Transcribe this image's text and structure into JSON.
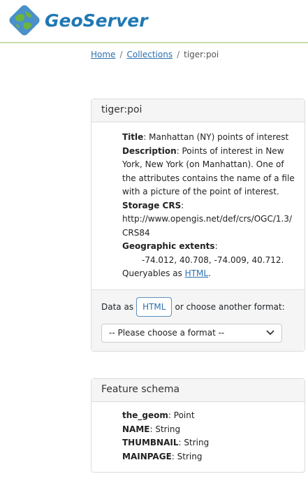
{
  "header": {
    "brand": "GeoServer"
  },
  "breadcrumb": {
    "home": "Home",
    "collections": "Collections",
    "current": "tiger:poi",
    "separator": "/"
  },
  "collection": {
    "title_header": "tiger:poi",
    "title_label": "Title",
    "title_value": ": Manhattan (NY) points of interest",
    "description_label": "Description",
    "description_value": ": Points of interest in New York, New York (on Manhattan). One of the attributes contains the name of a file with a picture of the point of interest.",
    "crs_label": "Storage CRS",
    "crs_colon": ":",
    "crs_value": "http://www.opengis.net/def/crs/OGC/1.3/CRS84",
    "extents_label": "Geographic extents",
    "extents_colon": ":",
    "extents_value": "-74.012, 40.708, -74.009, 40.712.",
    "queryables_prefix": "Queryables as ",
    "queryables_link": "HTML",
    "queryables_suffix": "."
  },
  "format": {
    "data_as": "Data as",
    "html_button": "HTML",
    "or_choose": "or choose another format:",
    "select_placeholder": "-- Please choose a format --"
  },
  "schema": {
    "header": "Feature schema",
    "fields": [
      {
        "name": "the_geom",
        "type": ": Point"
      },
      {
        "name": "NAME",
        "type": ": String"
      },
      {
        "name": "THUMBNAIL",
        "type": ": String"
      },
      {
        "name": "MAINPAGE",
        "type": ": String"
      }
    ]
  },
  "colors": {
    "brand": "#1f78b4",
    "link": "#2a6fb0",
    "header_rule": "#c9dca8"
  }
}
